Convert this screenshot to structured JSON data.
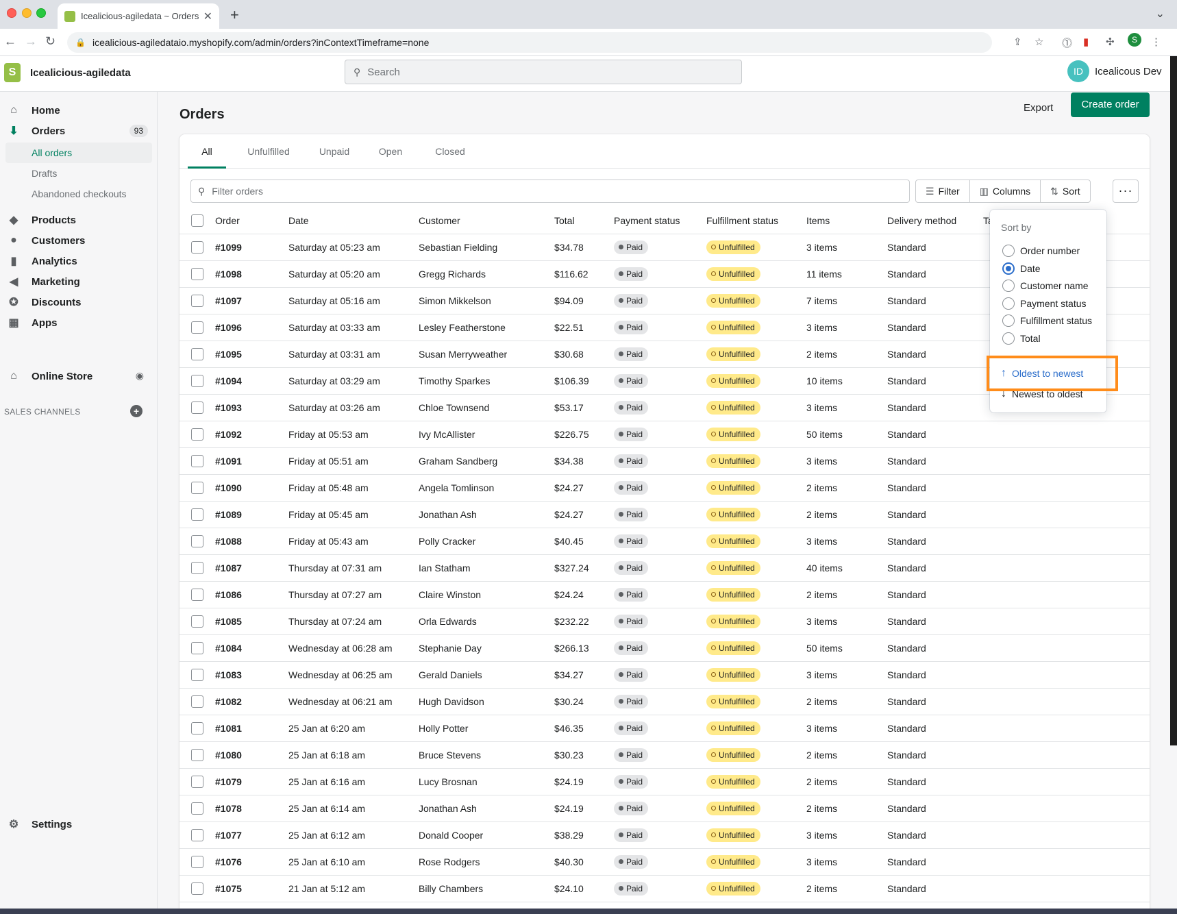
{
  "browser": {
    "tab_title": "Icealicious-agiledata ~ Orders",
    "url": "icealicious-agiledataio.myshopify.com/admin/orders?inContextTimeframe=none",
    "profile_initial": "S"
  },
  "topbar": {
    "store_name": "Icealicious-agiledata",
    "search_placeholder": "Search",
    "user_initials": "ID",
    "user_name": "Icealicous Dev"
  },
  "sidebar": {
    "home": "Home",
    "orders": "Orders",
    "orders_count": "93",
    "all_orders": "All orders",
    "drafts": "Drafts",
    "abandoned": "Abandoned checkouts",
    "products": "Products",
    "customers": "Customers",
    "analytics": "Analytics",
    "marketing": "Marketing",
    "discounts": "Discounts",
    "apps": "Apps",
    "sales_channels": "SALES CHANNELS",
    "online_store": "Online Store",
    "settings": "Settings"
  },
  "page": {
    "title": "Orders",
    "export": "Export",
    "create_order": "Create order",
    "tabs": [
      "All",
      "Unfulfilled",
      "Unpaid",
      "Open",
      "Closed"
    ],
    "filter_placeholder": "Filter orders",
    "filter": "Filter",
    "columns": "Columns",
    "sort": "Sort",
    "more": "···"
  },
  "table": {
    "headers": [
      "Order",
      "Date",
      "Customer",
      "Total",
      "Payment status",
      "Fulfillment status",
      "Items",
      "Delivery method",
      "Ta"
    ],
    "rows": [
      [
        "#1099",
        "Saturday at 05:23 am",
        "Sebastian Fielding",
        "$34.78",
        "Paid",
        "Unfulfilled",
        "3 items",
        "Standard"
      ],
      [
        "#1098",
        "Saturday at 05:20 am",
        "Gregg Richards",
        "$116.62",
        "Paid",
        "Unfulfilled",
        "11 items",
        "Standard"
      ],
      [
        "#1097",
        "Saturday at 05:16 am",
        "Simon Mikkelson",
        "$94.09",
        "Paid",
        "Unfulfilled",
        "7 items",
        "Standard"
      ],
      [
        "#1096",
        "Saturday at 03:33 am",
        "Lesley Featherstone",
        "$22.51",
        "Paid",
        "Unfulfilled",
        "3 items",
        "Standard"
      ],
      [
        "#1095",
        "Saturday at 03:31 am",
        "Susan Merryweather",
        "$30.68",
        "Paid",
        "Unfulfilled",
        "2 items",
        "Standard"
      ],
      [
        "#1094",
        "Saturday at 03:29 am",
        "Timothy Sparkes",
        "$106.39",
        "Paid",
        "Unfulfilled",
        "10 items",
        "Standard"
      ],
      [
        "#1093",
        "Saturday at 03:26 am",
        "Chloe Townsend",
        "$53.17",
        "Paid",
        "Unfulfilled",
        "3 items",
        "Standard"
      ],
      [
        "#1092",
        "Friday at 05:53 am",
        "Ivy McAllister",
        "$226.75",
        "Paid",
        "Unfulfilled",
        "50 items",
        "Standard"
      ],
      [
        "#1091",
        "Friday at 05:51 am",
        "Graham Sandberg",
        "$34.38",
        "Paid",
        "Unfulfilled",
        "3 items",
        "Standard"
      ],
      [
        "#1090",
        "Friday at 05:48 am",
        "Angela Tomlinson",
        "$24.27",
        "Paid",
        "Unfulfilled",
        "2 items",
        "Standard"
      ],
      [
        "#1089",
        "Friday at 05:45 am",
        "Jonathan Ash",
        "$24.27",
        "Paid",
        "Unfulfilled",
        "2 items",
        "Standard"
      ],
      [
        "#1088",
        "Friday at 05:43 am",
        "Polly Cracker",
        "$40.45",
        "Paid",
        "Unfulfilled",
        "3 items",
        "Standard"
      ],
      [
        "#1087",
        "Thursday at 07:31 am",
        "Ian Statham",
        "$327.24",
        "Paid",
        "Unfulfilled",
        "40 items",
        "Standard"
      ],
      [
        "#1086",
        "Thursday at 07:27 am",
        "Claire Winston",
        "$24.24",
        "Paid",
        "Unfulfilled",
        "2 items",
        "Standard"
      ],
      [
        "#1085",
        "Thursday at 07:24 am",
        "Orla Edwards",
        "$232.22",
        "Paid",
        "Unfulfilled",
        "3 items",
        "Standard"
      ],
      [
        "#1084",
        "Wednesday at 06:28 am",
        "Stephanie Day",
        "$266.13",
        "Paid",
        "Unfulfilled",
        "50 items",
        "Standard"
      ],
      [
        "#1083",
        "Wednesday at 06:25 am",
        "Gerald Daniels",
        "$34.27",
        "Paid",
        "Unfulfilled",
        "3 items",
        "Standard"
      ],
      [
        "#1082",
        "Wednesday at 06:21 am",
        "Hugh Davidson",
        "$30.24",
        "Paid",
        "Unfulfilled",
        "2 items",
        "Standard"
      ],
      [
        "#1081",
        "25 Jan at 6:20 am",
        "Holly Potter",
        "$46.35",
        "Paid",
        "Unfulfilled",
        "3 items",
        "Standard"
      ],
      [
        "#1080",
        "25 Jan at 6:18 am",
        "Bruce Stevens",
        "$30.23",
        "Paid",
        "Unfulfilled",
        "2 items",
        "Standard"
      ],
      [
        "#1079",
        "25 Jan at 6:16 am",
        "Lucy Brosnan",
        "$24.19",
        "Paid",
        "Unfulfilled",
        "2 items",
        "Standard"
      ],
      [
        "#1078",
        "25 Jan at 6:14 am",
        "Jonathan Ash",
        "$24.19",
        "Paid",
        "Unfulfilled",
        "2 items",
        "Standard"
      ],
      [
        "#1077",
        "25 Jan at 6:12 am",
        "Donald Cooper",
        "$38.29",
        "Paid",
        "Unfulfilled",
        "3 items",
        "Standard"
      ],
      [
        "#1076",
        "25 Jan at 6:10 am",
        "Rose Rodgers",
        "$40.30",
        "Paid",
        "Unfulfilled",
        "3 items",
        "Standard"
      ],
      [
        "#1075",
        "21 Jan at 5:12 am",
        "Billy Chambers",
        "$24.10",
        "Paid",
        "Unfulfilled",
        "2 items",
        "Standard"
      ]
    ]
  },
  "sort_menu": {
    "title": "Sort by",
    "options": [
      "Order number",
      "Date",
      "Customer name",
      "Payment status",
      "Fulfillment status",
      "Total"
    ],
    "selected": "Date",
    "oldest": "Oldest to newest",
    "newest": "Newest to oldest"
  },
  "colors": {
    "accent": "#008060",
    "highlight": "#ff8c1a",
    "link": "#2c6ecb"
  }
}
